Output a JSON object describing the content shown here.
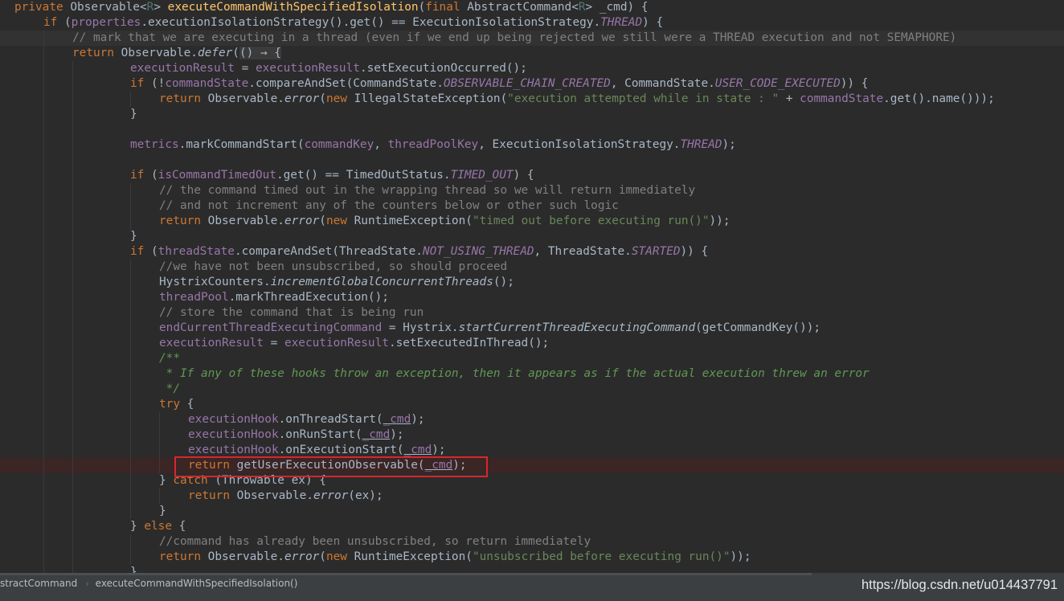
{
  "breadcrumb": {
    "class_name": "stractCommand",
    "method_name": "executeCommandWithSpecifiedIsolation()",
    "separator": "›"
  },
  "watermark": "https://blog.csdn.net/u014437791",
  "code": {
    "l1_private": "private",
    "l1_type": "Observable<",
    "l1_R": "R",
    "l1_close": ">",
    "l1_method": "executeCommandWithSpecifiedIsolation",
    "l1_paren": "(",
    "l1_final": "final",
    "l1_ptype": "AbstractCommand<",
    "l1_R2": "R",
    "l1_rest": "> _cmd) {",
    "l2_if": "if",
    "l2_a": "(",
    "l2_props": "properties",
    "l2_b": ".executionIsolationStrategy().get() == ExecutionIsolationStrategy.",
    "l2_thread": "THREAD",
    "l2_c": ") {",
    "l3_comment": "// mark that we are executing in a thread (even if we end up being rejected we still were a THREAD execution and not SEMAPHORE)",
    "l4_return": "return",
    "l4_a": "Observable.",
    "l4_defer": "defer",
    "l4_b": "(",
    "l4_lambda": "() → {",
    "l5_er": "executionResult",
    "l5_eq": " = ",
    "l5_er2": "executionResult",
    "l5_rest": ".setExecutionOccurred();",
    "l6_if": "if",
    "l6_a": "(!",
    "l6_cs": "commandState",
    "l6_b": ".compareAndSet(CommandState.",
    "l6_c1": "OBSERVABLE_CHAIN_CREATED",
    "l6_c": ", CommandState.",
    "l6_c2": "USER_CODE_EXECUTED",
    "l6_d": ")) {",
    "l7_return": "return",
    "l7_a": "Observable.",
    "l7_error": "error",
    "l7_b": "(",
    "l7_new": "new",
    "l7_c": "IllegalStateException(",
    "l7_str": "\"execution attempted while in state : \"",
    "l7_d": " + ",
    "l7_cs": "commandState",
    "l7_e": ".get().name()));",
    "l8": "}",
    "l10_metrics": "metrics",
    "l10_a": ".markCommandStart(",
    "l10_ck": "commandKey",
    "l10_b": ", ",
    "l10_tpk": "threadPoolKey",
    "l10_c": ", ExecutionIsolationStrategy.",
    "l10_thread": "THREAD",
    "l10_d": ");",
    "l12_if": "if",
    "l12_a": "(",
    "l12_ito": "isCommandTimedOut",
    "l12_b": ".get() == TimedOutStatus.",
    "l12_to": "TIMED_OUT",
    "l12_c": ") {",
    "l13_comment": "// the command timed out in the wrapping thread so we will return immediately",
    "l14_comment": "// and not increment any of the counters below or other such logic",
    "l15_return": "return",
    "l15_a": "Observable.",
    "l15_error": "error",
    "l15_b": "(",
    "l15_new": "new",
    "l15_c": "RuntimeException(",
    "l15_str": "\"timed out before executing run()\"",
    "l15_d": "));",
    "l16": "}",
    "l17_if": "if",
    "l17_a": "(",
    "l17_ts": "threadState",
    "l17_b": ".compareAndSet(ThreadState.",
    "l17_c1": "NOT_USING_THREAD",
    "l17_c": ", ThreadState.",
    "l17_c2": "STARTED",
    "l17_d": ")) {",
    "l18_comment": "//we have not been unsubscribed, so should proceed",
    "l19_a": "HystrixCounters.",
    "l19_fn": "incrementGlobalConcurrentThreads",
    "l19_b": "();",
    "l20_tp": "threadPool",
    "l20_a": ".markThreadExecution();",
    "l21_comment": "// store the command that is being run",
    "l22_ec": "endCurrentThreadExecutingCommand",
    "l22_a": " = Hystrix.",
    "l22_fn": "startCurrentThreadExecutingCommand",
    "l22_b": "(getCommandKey());",
    "l23_er": "executionResult",
    "l23_a": " = ",
    "l23_er2": "executionResult",
    "l23_b": ".setExecutedInThread();",
    "l24_doc": "/**",
    "l25_doc": " * If any of these hooks throw an exception, then it appears as if the actual execution threw an error",
    "l26_doc": " */",
    "l27_try": "try",
    "l27_a": " {",
    "l28_eh": "executionHook",
    "l28_a": ".onThreadStart(",
    "l28_cmd": "_cmd",
    "l28_b": ");",
    "l29_eh": "executionHook",
    "l29_a": ".onRunStart(",
    "l29_cmd": "_cmd",
    "l29_b": ");",
    "l30_eh": "executionHook",
    "l30_a": ".onExecutionStart(",
    "l30_cmd": "_cmd",
    "l30_b": ");",
    "l31_return": "return",
    "l31_a": "getUserExecutionObservable(",
    "l31_cmd": "_cmd",
    "l31_b": ");",
    "l32_a": "} ",
    "l32_catch": "catch",
    "l32_b": " (Throwable ex) {",
    "l33_return": "return",
    "l33_a": "Observable.",
    "l33_error": "error",
    "l33_b": "(ex);",
    "l34": "}",
    "l35_a": "} ",
    "l35_else": "else",
    "l35_b": " {",
    "l36_comment": "//command has already been unsubscribed, so return immediately",
    "l37_return": "return",
    "l37_a": "Observable.",
    "l37_error": "error",
    "l37_b": "(",
    "l37_new": "new",
    "l37_c": "RuntimeException(",
    "l37_str": "\"unsubscribed before executing run()\"",
    "l37_d": "));",
    "l38": "}"
  }
}
